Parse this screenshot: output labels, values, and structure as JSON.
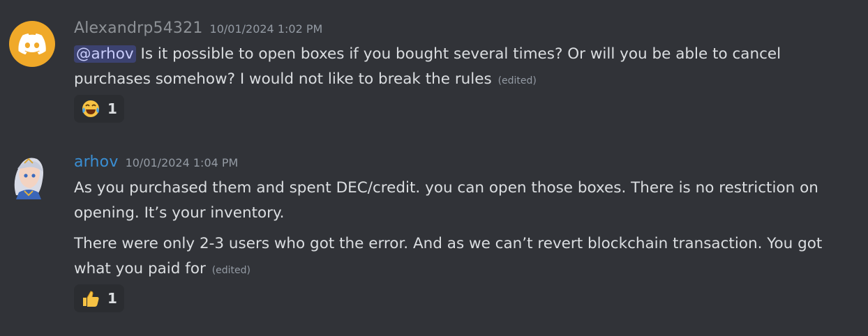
{
  "messages": [
    {
      "username": "Alexandrp54321",
      "timestamp": "10/01/2024 1:02 PM",
      "mention": "@arhov",
      "text_line1": " Is it possible to open boxes if you bought several times? Or will you be able to cancel",
      "text_line2": "purchases somehow? I would not like to break the rules",
      "edited": "(edited)",
      "reaction": {
        "emoji": "laughing-crying",
        "count": "1"
      }
    },
    {
      "username": "arhov",
      "timestamp": "10/01/2024 1:04 PM",
      "paragraph1_line1": "As you purchased them and spent DEC/credit. you can open those boxes. There is no restriction on",
      "paragraph1_line2": "opening. It’s your inventory.",
      "paragraph2_line1": "There were only 2-3 users who got the error. And as we can’t revert blockchain transaction. You got",
      "paragraph2_line2": "what you paid for",
      "edited": "(edited)",
      "reaction": {
        "emoji": "thumbs-up",
        "count": "1"
      }
    }
  ]
}
